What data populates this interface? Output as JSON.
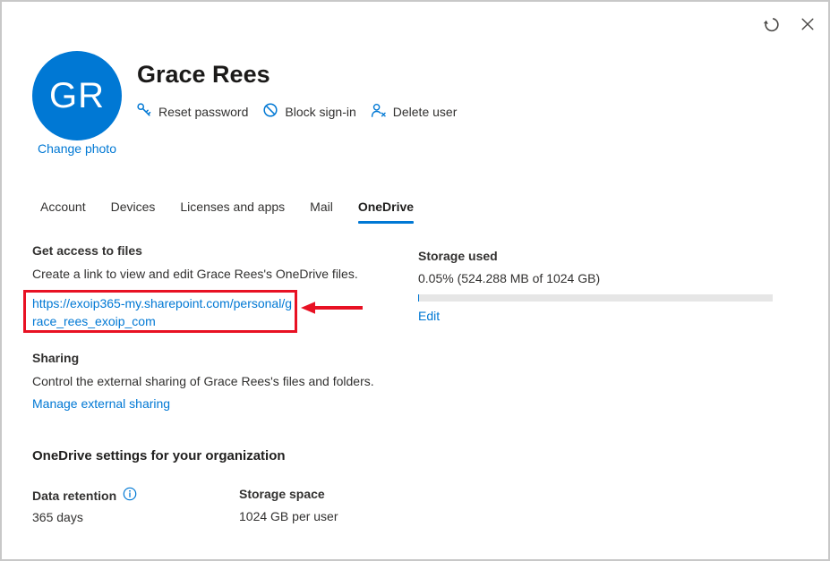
{
  "colors": {
    "accent": "#0078d4",
    "annotation_red": "#e81123",
    "text": "#323130",
    "progress_track": "#e6e6e6",
    "avatar_bg": "#0078d4"
  },
  "window": {
    "refresh_icon": "refresh-icon",
    "close_icon": "close-icon"
  },
  "profile": {
    "initials": "GR",
    "name": "Grace Rees",
    "change_photo_label": "Change photo",
    "actions": [
      {
        "icon": "key-icon",
        "label": "Reset password"
      },
      {
        "icon": "block-icon",
        "label": "Block sign-in"
      },
      {
        "icon": "delete-user-icon",
        "label": "Delete user"
      }
    ]
  },
  "tabs": [
    {
      "label": "Account",
      "active": false
    },
    {
      "label": "Devices",
      "active": false
    },
    {
      "label": "Licenses and apps",
      "active": false
    },
    {
      "label": "Mail",
      "active": false
    },
    {
      "label": "OneDrive",
      "active": true
    }
  ],
  "onedrive": {
    "access": {
      "heading": "Get access to files",
      "description": "Create a link to view and edit Grace Rees's OneDrive files.",
      "link_url": "https://exoip365-my.sharepoint.com/personal/grace_rees_exoip_com",
      "link_text": "https://exoip365-my.sharepoint.com/personal/grace_rees_exoip_com",
      "annotation": "red-box-and-arrow"
    },
    "sharing": {
      "heading": "Sharing",
      "description": "Control the external sharing of Grace Rees's files and folders.",
      "manage_label": "Manage external sharing"
    },
    "storage_used": {
      "heading": "Storage used",
      "value": "0.05% (524.288 MB of 1024 GB)",
      "percent_used": 0.05,
      "edit_label": "Edit"
    },
    "org_settings": {
      "heading": "OneDrive settings for your organization",
      "data_retention_label": "Data retention",
      "data_retention_value": "365 days",
      "info_icon": "info-icon",
      "storage_space_label": "Storage space",
      "storage_space_value": "1024 GB per user"
    }
  }
}
